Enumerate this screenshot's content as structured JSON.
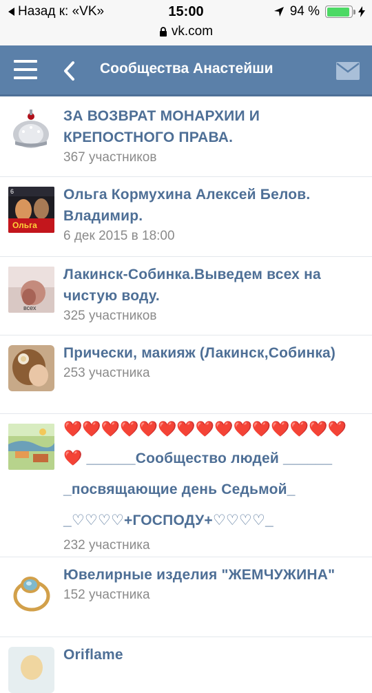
{
  "status_bar": {
    "back_text": "Назад к: «VK»",
    "time": "15:00",
    "battery_percent": "94 %",
    "battery_level": 0.94,
    "url": "vk.com"
  },
  "header": {
    "title": "Сообщества Анастейши"
  },
  "groups": [
    {
      "title": "ЗА ВОЗВРАТ МОНАРХИИ И КРЕПОСТНОГО ПРАВА.",
      "subtitle": "367 участников",
      "avatar_icon": "crown-image"
    },
    {
      "title": "Ольга Кормухина Алексей Белов. Владимир.",
      "subtitle": "6 дек 2015 в 18:00",
      "avatar_icon": "concert-poster-image"
    },
    {
      "title": "Лакинск-Собинка.Выведем всех на чистую воду.",
      "subtitle": "325 участников",
      "avatar_icon": "photo-image"
    },
    {
      "title": "Прически, макияж (Лакинск,Собинка)",
      "subtitle": "253 участника",
      "avatar_icon": "hairstyle-image"
    },
    {
      "title_hearts": "❤️❤️❤️❤️❤️❤️❤️❤️❤️❤️❤️❤️❤️❤️❤️",
      "title_line2_heart": "❤️",
      "title_line2_text": " ______Сообщество людей ______",
      "title_line3": "_посвящающие день Седьмой_",
      "title_line4": "_♡♡♡♡+ГОСПОДУ+♡♡♡♡_",
      "subtitle": "232 участника",
      "avatar_icon": "painting-image"
    },
    {
      "title": "Ювелирные изделия \"ЖЕМЧУЖИНА\"",
      "subtitle": "152 участника",
      "avatar_icon": "ring-image"
    },
    {
      "title": "Oriflame",
      "subtitle": "",
      "avatar_icon": "portrait-image"
    }
  ]
}
